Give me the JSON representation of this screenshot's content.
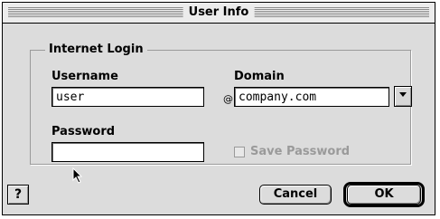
{
  "window": {
    "title": "User Info"
  },
  "group": {
    "label": "Internet Login"
  },
  "fields": {
    "username_label": "Username",
    "username_value": "user",
    "at_symbol": "@",
    "domain_label": "Domain",
    "domain_value": "company.com",
    "password_label": "Password",
    "password_value": ""
  },
  "save_password": {
    "label": "Save Password",
    "checked": false,
    "enabled": false
  },
  "buttons": {
    "help": "?",
    "cancel": "Cancel",
    "ok": "OK"
  },
  "icons": {
    "domain_popup": "triangle-down-icon",
    "cursor": "arrow-pointer-icon"
  }
}
